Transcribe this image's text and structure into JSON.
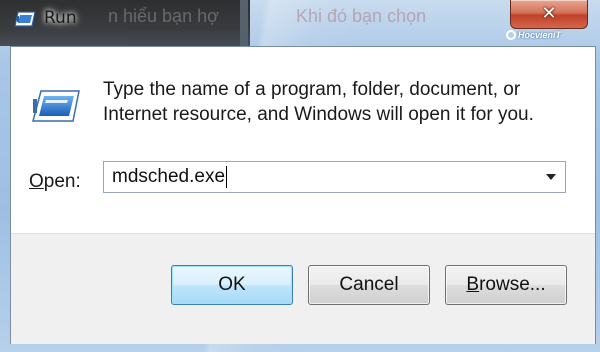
{
  "window": {
    "title": "Run",
    "close_symbol": "✕"
  },
  "background_text": {
    "left": "n hiểu bạn hợ",
    "right": "Khi đó bạn chọn "
  },
  "watermark": "HocvieniT",
  "dialog": {
    "description": "Type the name of a program, folder, document, or Internet resource, and Windows will open it for you.",
    "open_label_accel": "O",
    "open_label_rest": "pen:",
    "open_value": "mdsched.exe"
  },
  "buttons": {
    "ok": "OK",
    "cancel": "Cancel",
    "browse_accel": "B",
    "browse_rest": "rowse..."
  },
  "colors": {
    "ok_border": "#3c7fb1",
    "close_red": "#c0402a"
  }
}
